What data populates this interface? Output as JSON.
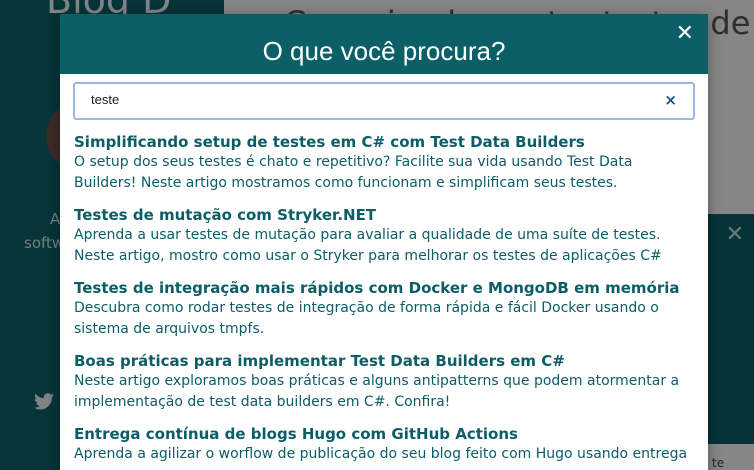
{
  "background": {
    "sidebar_title": "Blog D",
    "sidebar_text_1": "A",
    "sidebar_text_2": "softw",
    "main_title": "Como implementar testes de",
    "cut_text": "te"
  },
  "modal": {
    "title": "O que você procura?",
    "close_glyph": "✕",
    "search": {
      "value": "teste",
      "clear_glyph": "×"
    },
    "results": [
      {
        "title": "Simplificando setup de testes em C# com Test Data Builders",
        "description": "O setup dos seus testes é chato e repetitivo? Facilite sua vida usando Test Data Builders! Neste artigo mostramos como funcionam e simplificam seus testes."
      },
      {
        "title": "Testes de mutação com Stryker.NET",
        "description": "Aprenda a usar testes de mutação para avaliar a qualidade de uma suíte de testes. Neste artigo, mostro como usar o Stryker para melhorar os testes de aplicações C#"
      },
      {
        "title": "Testes de integração mais rápidos com Docker e MongoDB em memória",
        "description": "Descubra como rodar testes de integração de forma rápida e fácil Docker usando o sistema de arquivos tmpfs."
      },
      {
        "title": "Boas práticas para implementar Test Data Builders em C#",
        "description": "Neste artigo exploramos boas práticas e alguns antipatterns que podem atormentar a implementação de test data builders em C#. Confira!"
      },
      {
        "title": "Entrega contínua de blogs Hugo com GitHub Actions",
        "description": "Aprenda a agilizar o worflow de publicação do seu blog feito com Hugo usando entrega"
      }
    ]
  }
}
